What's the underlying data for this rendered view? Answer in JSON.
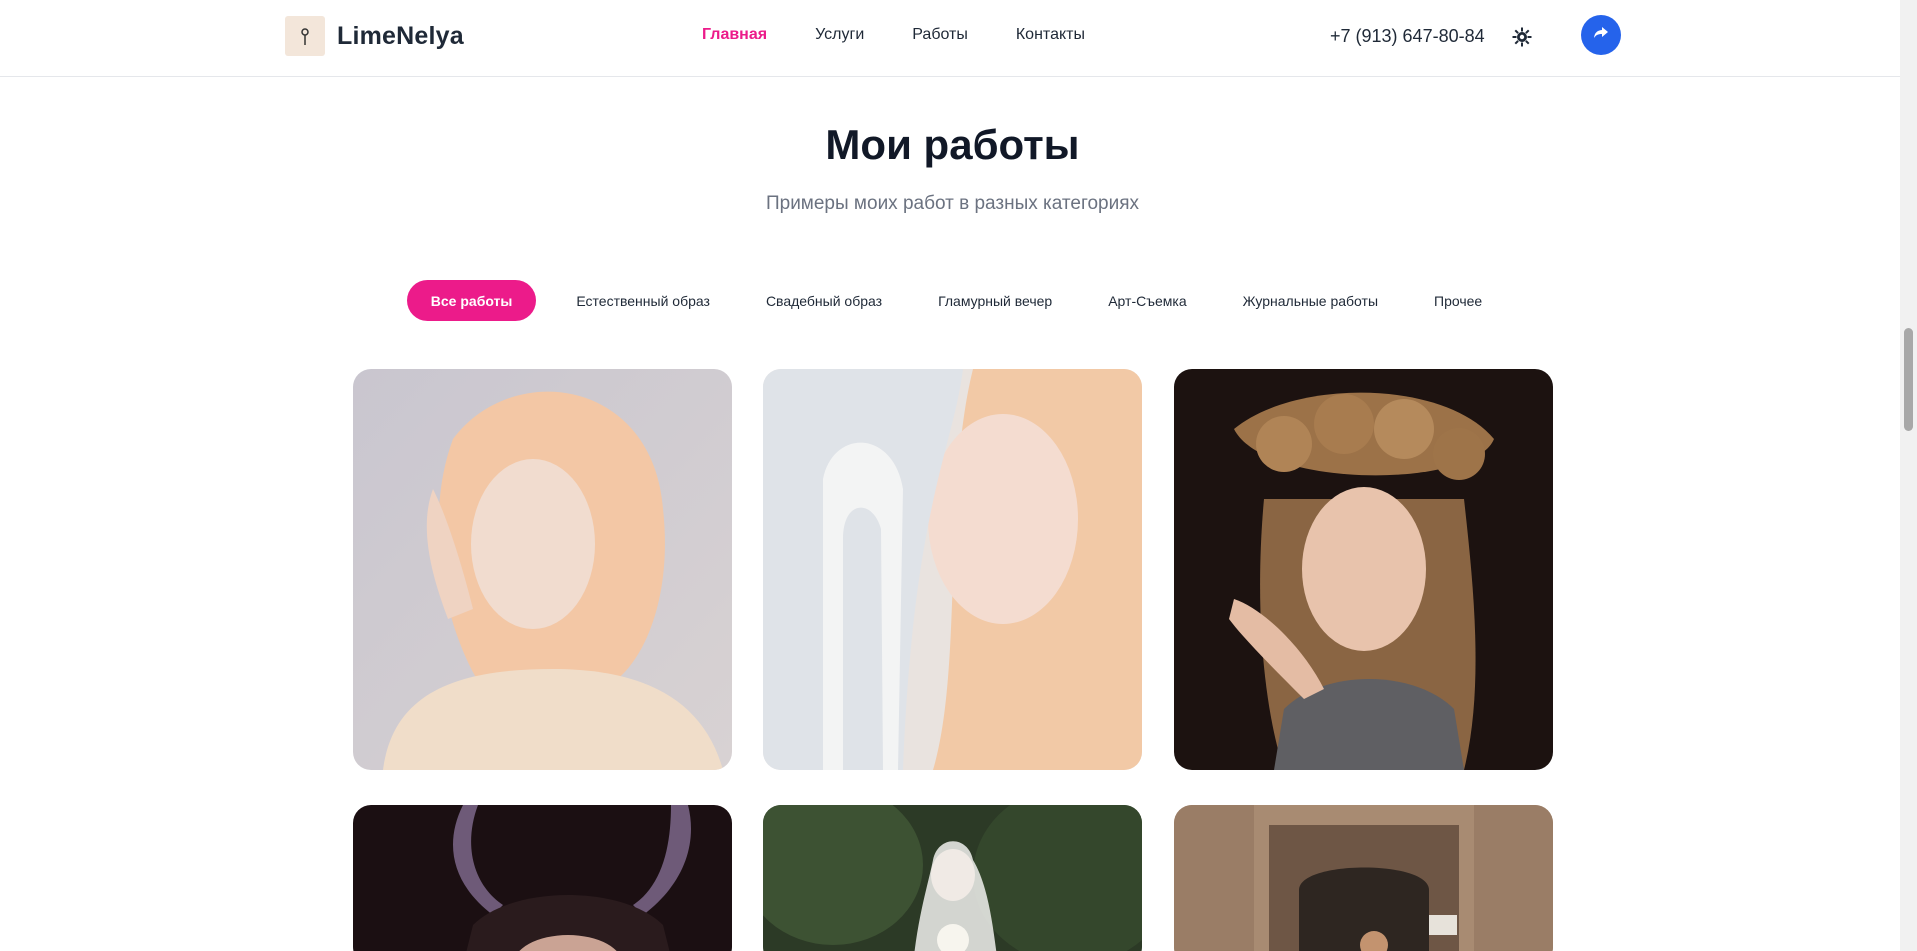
{
  "header": {
    "brand": "LimeNelya",
    "nav": [
      {
        "label": "Главная",
        "active": true
      },
      {
        "label": "Услуги",
        "active": false
      },
      {
        "label": "Работы",
        "active": false
      },
      {
        "label": "Контакты",
        "active": false
      }
    ],
    "phone": "+7 (913) 647-80-84",
    "icons": {
      "theme": "gear-icon",
      "share": "share-arrow-icon",
      "logo": "brush-icon"
    }
  },
  "section": {
    "title": "Мои работы",
    "subtitle": "Примеры моих работ в разных категориях"
  },
  "filters": [
    {
      "label": "Все работы",
      "active": true
    },
    {
      "label": "Естественный образ",
      "active": false
    },
    {
      "label": "Свадебный образ",
      "active": false
    },
    {
      "label": "Гламурный вечер",
      "active": false
    },
    {
      "label": "Арт-Съемка",
      "active": false
    },
    {
      "label": "Журнальные работы",
      "active": false
    },
    {
      "label": "Прочее",
      "active": false
    }
  ],
  "colors": {
    "accent": "#ec1b8a",
    "share": "#2563eb"
  },
  "gallery": {
    "photos": [
      {
        "name": "blonde-portrait-photo"
      },
      {
        "name": "mirror-portrait-photo"
      },
      {
        "name": "golden-crown-portrait-photo"
      },
      {
        "name": "horns-portrait-photo"
      },
      {
        "name": "wedding-bride-photo"
      },
      {
        "name": "archway-building-photo"
      }
    ]
  }
}
